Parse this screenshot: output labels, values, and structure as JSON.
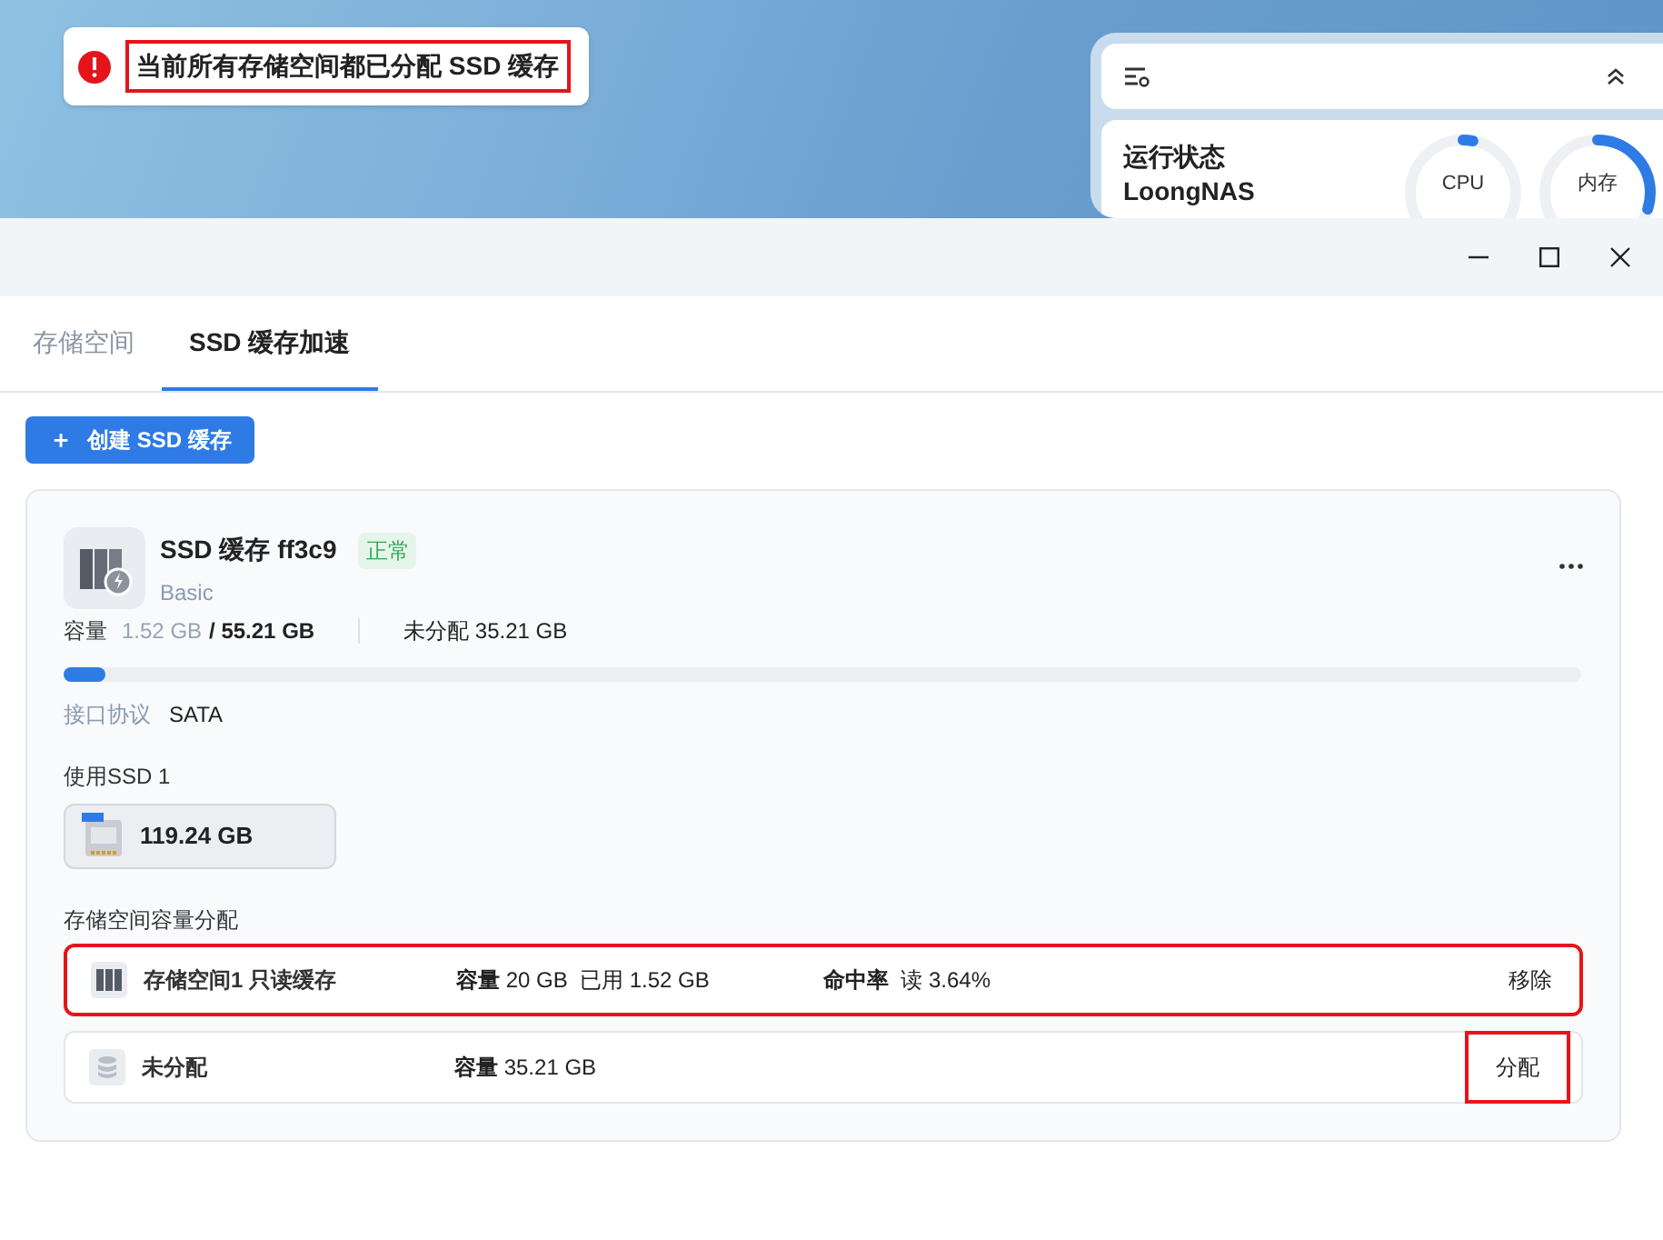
{
  "toast": {
    "message": "当前所有存储空间都已分配 SSD 缓存"
  },
  "widget": {
    "title": "运行状态",
    "device": "LoongNAS",
    "gauges": [
      {
        "label": "CPU",
        "level": 0.03
      },
      {
        "label": "内存",
        "level": 0.3
      }
    ]
  },
  "tabs": [
    {
      "label": "存储空间",
      "selected": false
    },
    {
      "label": "SSD 缓存加速",
      "selected": true
    }
  ],
  "create_button": {
    "icon": "＋",
    "label": "创建 SSD 缓存"
  },
  "cache": {
    "name": "SSD 缓存 ff3c9",
    "status": "正常",
    "type": "Basic",
    "capacity_label": "容量",
    "used": "1.52 GB",
    "total": "/ 55.21 GB",
    "unallocated": "未分配 35.21 GB",
    "level": 0.028,
    "interface_label": "接口协议",
    "interface": "SATA",
    "ssd_label": "使用SSD 1",
    "ssd_size": "119.24 GB",
    "allocation_label": "存储空间容量分配",
    "rows": [
      {
        "kind": "volume",
        "name": "存储空间1 只读缓存",
        "capacity_label": "容量",
        "capacity": "20 GB",
        "used": "已用 1.52 GB",
        "hit_label": "命中率",
        "hit": "读 3.64%",
        "action": "移除",
        "highlighted": true
      },
      {
        "kind": "free",
        "name": "未分配",
        "capacity_label": "容量",
        "capacity": "35.21 GB",
        "action": "分配",
        "highlighted": false
      }
    ]
  }
}
